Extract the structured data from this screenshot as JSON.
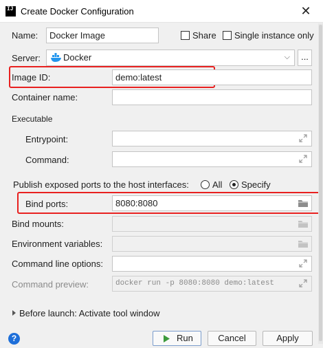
{
  "window": {
    "app_icon_text": "IJ",
    "title": "Create Docker Configuration",
    "close_glyph": "✕"
  },
  "name": {
    "label": "Name:",
    "value": "Docker Image"
  },
  "share": {
    "label": "Share",
    "checked": false
  },
  "single_instance": {
    "label": "Single instance only",
    "checked": false
  },
  "server": {
    "label": "Server:",
    "value": "Docker",
    "browse_label": "..."
  },
  "image_id": {
    "label": "Image ID:",
    "value": "demo:latest"
  },
  "container_name": {
    "label": "Container name:",
    "value": ""
  },
  "executable": {
    "section_label": "Executable",
    "entrypoint": {
      "label": "Entrypoint:",
      "value": ""
    },
    "command": {
      "label": "Command:",
      "value": ""
    }
  },
  "publish_ports": {
    "label": "Publish exposed ports to the host interfaces:",
    "options": [
      "All",
      "Specify"
    ],
    "selected": "Specify"
  },
  "bind_ports": {
    "label": "Bind ports:",
    "value": "8080:8080"
  },
  "bind_mounts": {
    "label": "Bind mounts:",
    "value": ""
  },
  "env_vars": {
    "label": "Environment variables:",
    "value": ""
  },
  "cmd_line_options": {
    "label": "Command line options:",
    "value": ""
  },
  "cmd_preview": {
    "label": "Command preview:",
    "value": "docker run -p 8080:8080 demo:latest"
  },
  "before_launch": {
    "label": "Before launch: Activate tool window"
  },
  "buttons": {
    "run": "Run",
    "cancel": "Cancel",
    "apply": "Apply",
    "help": "?"
  },
  "colors": {
    "highlight": "#e8201f",
    "docker_blue": "#2496ed",
    "help_blue": "#1e6fd9",
    "run_green": "#3c9a3c"
  }
}
